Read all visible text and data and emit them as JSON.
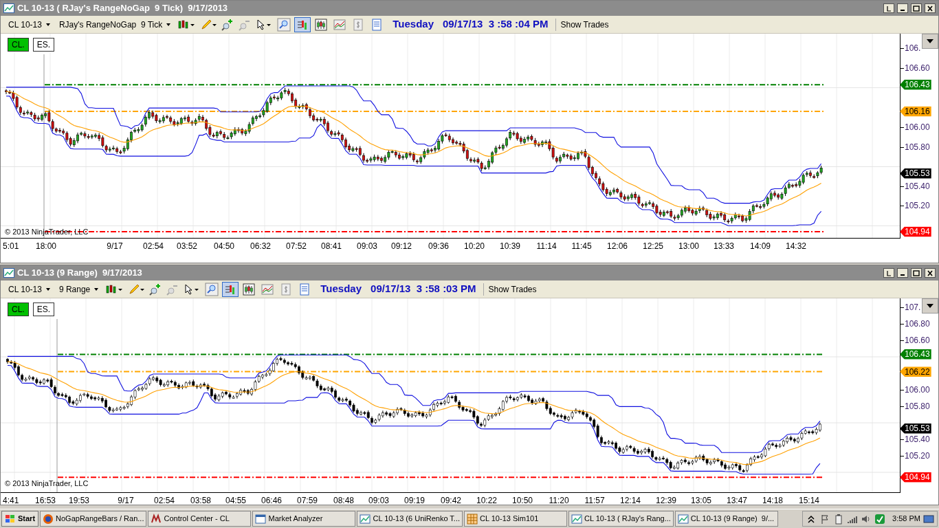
{
  "panes": [
    {
      "title": "CL 10-13 ( RJay's RangeNoGap  9 Tick)  9/17/2013",
      "toolbar": {
        "instrument": "CL 10-13",
        "period": "RJay's RangeNoGap  9 Tick",
        "day": "Tuesday",
        "datetime": "09/17/13  3 :58 :04 PM",
        "show_trades": "Show Trades"
      },
      "tools": [
        {
          "kind": "bars",
          "pressed": true
        },
        {
          "kind": "candles"
        },
        {
          "kind": "indicator"
        },
        {
          "kind": "strategy"
        },
        {
          "kind": "properties"
        }
      ],
      "chart_tabs": [
        {
          "label": "CL.",
          "selected": true
        },
        {
          "label": "ES.",
          "selected": false
        }
      ],
      "kind": "colored_candles",
      "y_labels": [
        "106.",
        "106.60",
        "106.00",
        "105.80",
        "105.40",
        "105.20"
      ],
      "markers": [
        {
          "text": "106.43",
          "color": "#008000"
        },
        {
          "text": "106.16",
          "color": "#ffa500"
        },
        {
          "text": "105.53",
          "color": "#000000"
        },
        {
          "text": "104.94",
          "color": "#ff0000"
        }
      ],
      "x_labels": [
        "5:01",
        "18:00",
        "9/17",
        "02:54",
        "03:52",
        "04:50",
        "06:32",
        "07:52",
        "08:41",
        "09:03",
        "09:12",
        "09:36",
        "10:20",
        "10:39",
        "11:14",
        "11:45",
        "12:06",
        "12:25",
        "13:00",
        "13:33",
        "14:09",
        "14:32"
      ],
      "copyright": "© 2013 NinjaTrader, LLC"
    },
    {
      "title": "CL 10-13 (9 Range)  9/17/2013",
      "toolbar": {
        "instrument": "CL 10-13",
        "period": "9 Range",
        "day": "Tuesday",
        "datetime": "09/17/13  3 :58 :03 PM",
        "show_trades": "Show Trades"
      },
      "tools": [
        {
          "kind": "bars",
          "pressed": true
        },
        {
          "kind": "candles"
        },
        {
          "kind": "indicator"
        },
        {
          "kind": "strategy"
        },
        {
          "kind": "properties"
        }
      ],
      "chart_tabs": [
        {
          "label": "CL.",
          "selected": true
        },
        {
          "label": "ES.",
          "selected": false
        }
      ],
      "kind": "mono_candles",
      "y_labels": [
        "107.",
        "106.80",
        "106.60",
        "106.00",
        "105.80",
        "105.40",
        "105.20"
      ],
      "markers": [
        {
          "text": "106.43",
          "color": "#008000"
        },
        {
          "text": "106.22",
          "color": "#ffa500"
        },
        {
          "text": "105.53",
          "color": "#000000"
        },
        {
          "text": "104.94",
          "color": "#ff0000"
        }
      ],
      "x_labels": [
        "4:41",
        "16:53",
        "19:53",
        "9/17",
        "02:54",
        "03:58",
        "04:55",
        "06:46",
        "07:59",
        "08:48",
        "09:03",
        "09:19",
        "09:42",
        "10:22",
        "10:50",
        "11:20",
        "11:57",
        "12:14",
        "12:39",
        "13:05",
        "13:47",
        "14:18",
        "15:14"
      ],
      "copyright": "© 2013 NinjaTrader, LLC"
    }
  ],
  "taskbar": {
    "start": "Start",
    "items": [
      {
        "label": "NoGapRangeBars / Ran...",
        "kind": "browser"
      },
      {
        "label": "Control Center - CL",
        "kind": "ninja"
      },
      {
        "label": "Market Analyzer",
        "kind": "window"
      },
      {
        "label": "CL 10-13 (6 UniRenko T...",
        "kind": "chart"
      },
      {
        "label": "CL 10-13 Sim101",
        "kind": "grid"
      },
      {
        "label": "CL 10-13 ( RJay's Rang...",
        "kind": "chart"
      },
      {
        "label": "CL 10-13 (9 Range)  9/...",
        "kind": "chart"
      }
    ],
    "clock": "3:58 PM"
  }
}
